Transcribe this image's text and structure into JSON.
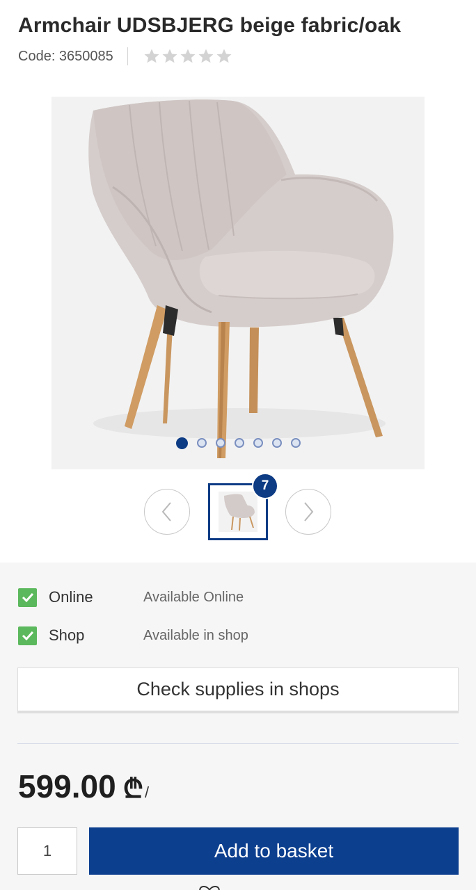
{
  "product": {
    "title": "Armchair UDSBJERG beige fabric/oak",
    "code_label": "Code: 3650085",
    "rating_stars": 0,
    "rating_max": 5
  },
  "gallery": {
    "image_count": 7,
    "active_index": 0,
    "thumb_badge": "7"
  },
  "availability": [
    {
      "label": "Online",
      "status": "Available Online",
      "available": true
    },
    {
      "label": "Shop",
      "status": "Available in shop",
      "available": true
    }
  ],
  "check_supplies_label": "Check supplies in shops",
  "price": {
    "amount": "599.00",
    "currency": "₾",
    "suffix": "/"
  },
  "quantity": "1",
  "add_to_basket_label": "Add to basket",
  "colors": {
    "brand": "#0d3f8f",
    "available": "#5cb85c"
  },
  "icons": {
    "prev": "chevron-left-icon",
    "next": "chevron-right-icon",
    "available": "checkmark-icon",
    "rating": "star-icon",
    "wishlist": "heart-icon"
  }
}
